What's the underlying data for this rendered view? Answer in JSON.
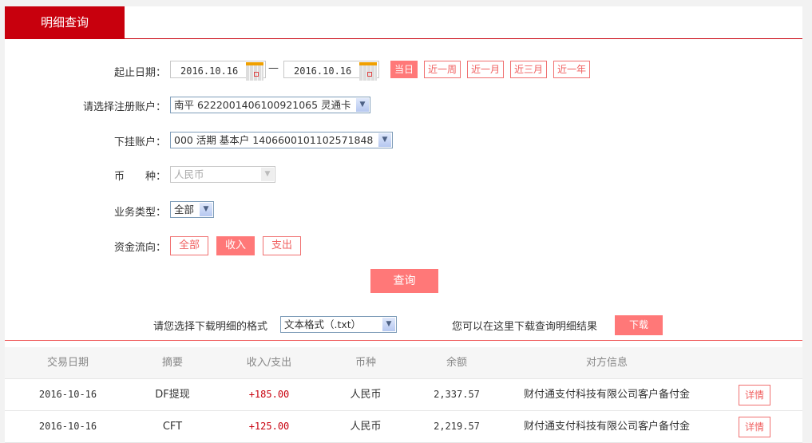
{
  "tab": {
    "title": "明细查询"
  },
  "form": {
    "date_label": "起止日期：",
    "date_from": "2016.10.16",
    "date_sep": "—",
    "date_to": "2016.10.16",
    "quick_ranges": [
      {
        "label": "当日",
        "active": true
      },
      {
        "label": "近一周"
      },
      {
        "label": "近一月"
      },
      {
        "label": "近三月"
      },
      {
        "label": "近一年"
      }
    ],
    "account_label": "请选择注册账户：",
    "account_value": "南平 6222001406100921065 灵通卡",
    "sub_account_label": "下挂账户：",
    "sub_account_value": "000 活期 基本户 1406600101102571848",
    "currency_label": "币　　种：",
    "currency_value": "人民币",
    "biz_type_label": "业务类型：",
    "biz_type_value": "全部",
    "flow_label": "资金流向：",
    "flow_options": [
      {
        "label": "全部"
      },
      {
        "label": "收入",
        "active": true
      },
      {
        "label": "支出"
      }
    ],
    "query_label": "查询"
  },
  "download": {
    "format_label": "请您选择下载明细的格式",
    "format_value": "文本格式（.txt）",
    "hint": "您可以在这里下载查询明细结果",
    "button": "下载"
  },
  "table": {
    "headers": [
      "交易日期",
      "摘要",
      "收入/支出",
      "币种",
      "余额",
      "对方信息"
    ],
    "rows": [
      {
        "date": "2016-10-16",
        "summary": "DF提现",
        "amount": "+185.00",
        "currency": "人民币",
        "balance": "2,337.57",
        "counterparty": "财付通支付科技有限公司客户备付金",
        "action": "详情"
      },
      {
        "date": "2016-10-16",
        "summary": "CFT",
        "amount": "+125.00",
        "currency": "人民币",
        "balance": "2,219.57",
        "counterparty": "财付通支付科技有限公司客户备付金",
        "action": "详情"
      }
    ]
  },
  "colors": {
    "brand": "#c8000d",
    "accent": "#ff7878"
  }
}
